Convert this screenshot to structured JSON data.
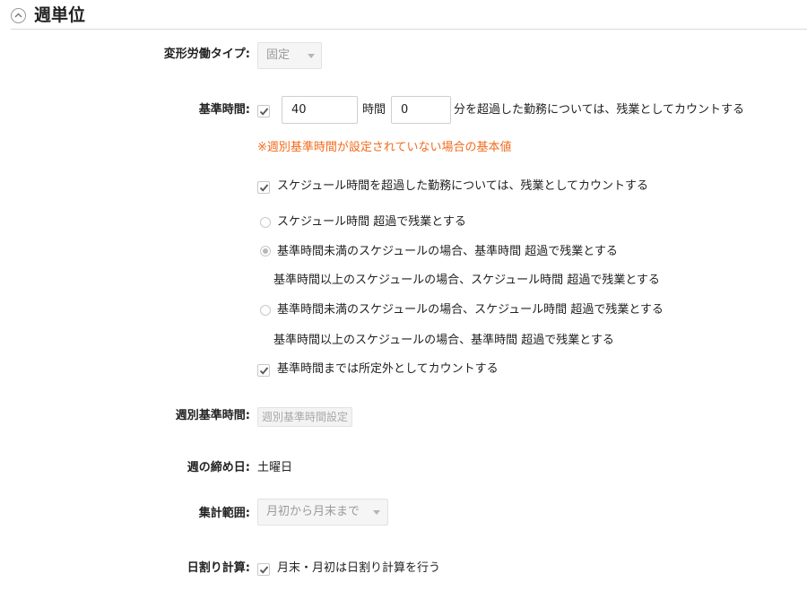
{
  "section": {
    "title": "週単位",
    "collapse_icon": "chevron-up-icon"
  },
  "fields": {
    "variable_labor_type": {
      "label": "変形労働タイプ:",
      "value": "固定"
    },
    "standard_time": {
      "label": "基準時間:",
      "checked": true,
      "hours_value": "40",
      "hours_unit": "時間",
      "minutes_value": "0",
      "suffix": "分を超過した勤務については、残業としてカウントする",
      "note": "※週別基準時間が設定されていない場合の基本値"
    },
    "schedule_overtime": {
      "label": "スケジュール時間を超過した勤務については、残業としてカウントする",
      "checked": true
    },
    "radio_options": [
      {
        "line1": "スケジュール時間 超過で残業とする",
        "line2": "",
        "checked": false
      },
      {
        "line1": "基準時間未満のスケジュールの場合、基準時間 超過で残業とする",
        "line2": "基準時間以上のスケジュールの場合、スケジュール時間 超過で残業とする",
        "checked": true
      },
      {
        "line1": "基準時間未満のスケジュールの場合、スケジュール時間 超過で残業とする",
        "line2": "基準時間以上のスケジュールの場合、基準時間 超過で残業とする",
        "checked": false
      }
    ],
    "outside_prescribed": {
      "label": "基準時間までは所定外としてカウントする",
      "checked": true
    },
    "weekly_standard_time": {
      "label": "週別基準時間:",
      "button": "週別基準時間設定"
    },
    "week_closing_day": {
      "label": "週の締め日:",
      "value": "土曜日"
    },
    "aggregation_range": {
      "label": "集計範囲:",
      "value": "月初から月末まで"
    },
    "daily_proration": {
      "label": "日割り計算:",
      "checkbox_label": "月末・月初は日割り計算を行う",
      "checked": true
    }
  },
  "colors": {
    "note": "#f26b1d",
    "disabled_text": "#9a9a9a",
    "check": "#555555"
  }
}
